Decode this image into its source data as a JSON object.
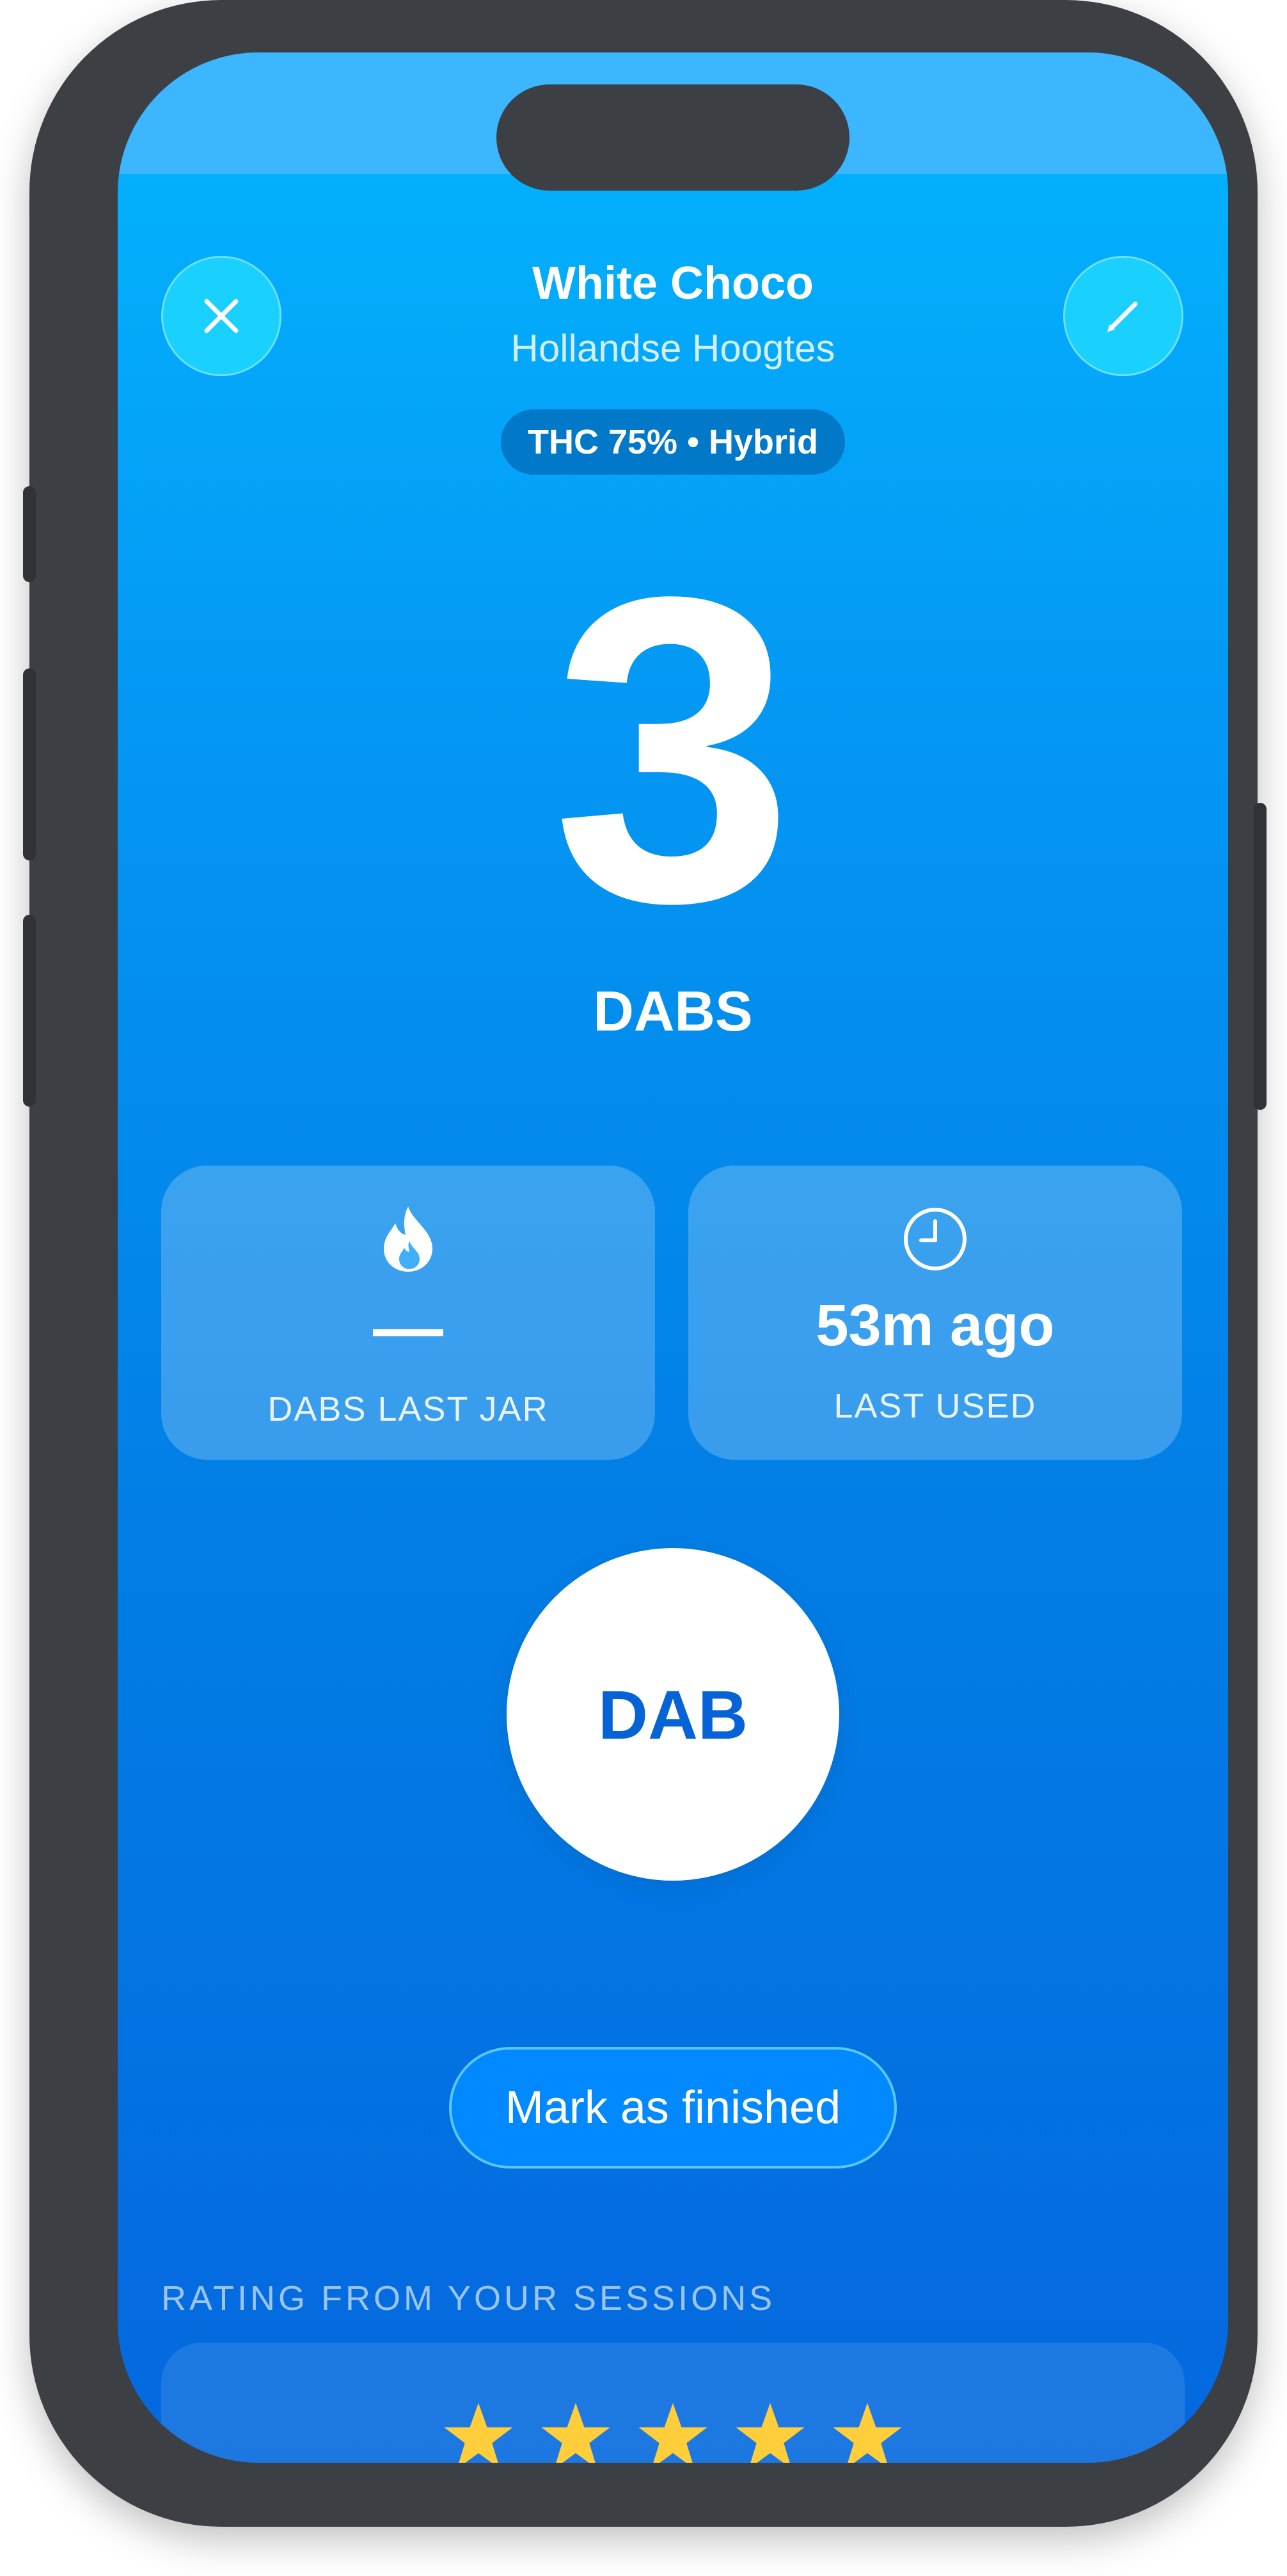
{
  "header": {
    "title": "White Choco",
    "subtitle": "Hollandse Hoogtes",
    "badge": "THC 75% • Hybrid",
    "close_icon": "close-icon",
    "edit_icon": "pencil-icon"
  },
  "counter": {
    "value": "3",
    "label": "DABS"
  },
  "stats": {
    "left": {
      "icon": "flame-icon",
      "value": "—",
      "label": "DABS LAST JAR"
    },
    "right": {
      "icon": "clock-icon",
      "value": "53m ago",
      "label": "LAST USED"
    }
  },
  "actions": {
    "dab_label": "DAB",
    "finish_label": "Mark as finished"
  },
  "rating": {
    "section_title": "RATING FROM YOUR SESSIONS",
    "stars": 5,
    "max_stars": 5,
    "star_color": "#ffce3a"
  },
  "colors": {
    "gradient_top": "#03b5ff",
    "gradient_bottom": "#0468de",
    "dab_text": "#0563d6"
  }
}
